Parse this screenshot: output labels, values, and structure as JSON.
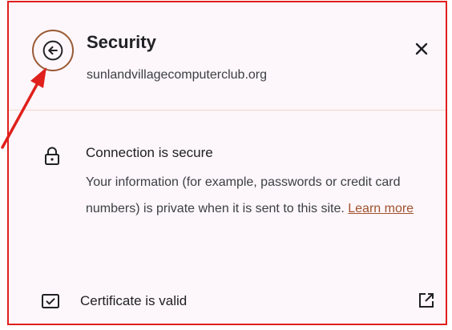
{
  "header": {
    "title": "Security",
    "site": "sunlandvillagecomputerclub.org",
    "back_icon": "arrow-left-icon",
    "close_icon": "close-icon"
  },
  "connection": {
    "title": "Connection is secure",
    "description": "Your information (for example, passwords or credit card numbers) is private when it is sent to this site.",
    "learn_more": "Learn more",
    "icon": "lock-icon"
  },
  "certificate": {
    "label": "Certificate is valid",
    "icon": "certificate-icon",
    "external_icon": "open-in-new-icon"
  },
  "colors": {
    "panel_bg": "#fdf6fa",
    "border": "#e0201c",
    "annotation_arrow": "#e0201c",
    "back_ring": "#9a5a35",
    "link": "#a0522d"
  }
}
